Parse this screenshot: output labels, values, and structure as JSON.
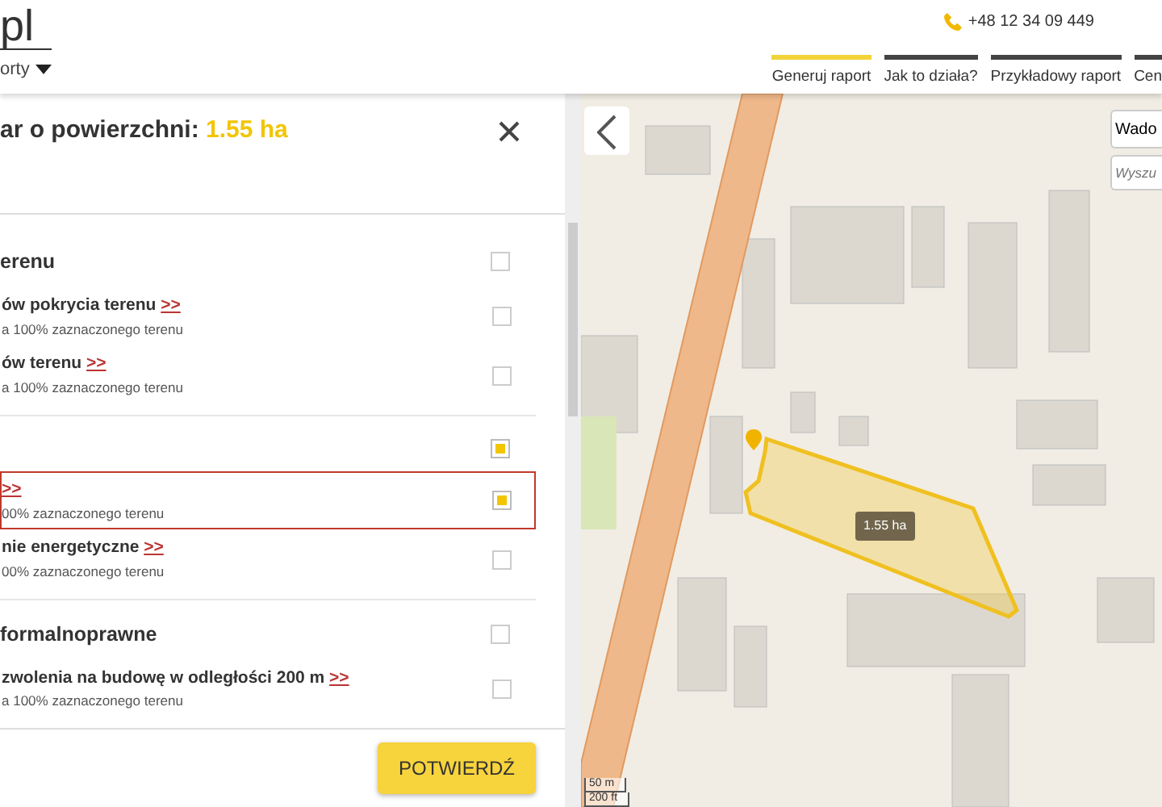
{
  "header": {
    "logo": "pl",
    "menu": "orty",
    "phone": "+48 12 34 09 449",
    "nav": [
      {
        "label": "Generuj raport",
        "selected": true
      },
      {
        "label": "Jak to działa?",
        "selected": false
      },
      {
        "label": "Przykładowy raport",
        "selected": false
      },
      {
        "label": "Cen",
        "selected": false
      }
    ]
  },
  "panel": {
    "title": "ar o powierzchni: ",
    "area": "1.55 ha",
    "confirm": "POTWIERDŹ",
    "sections": [
      {
        "title": "erenu",
        "checked": false,
        "items": [
          {
            "label": "ów pokrycia terenu",
            "link": ">>",
            "note": "a 100% zaznaczonego terenu",
            "checked": false,
            "highlighted": false
          },
          {
            "label": "ów terenu",
            "link": ">>",
            "note": "a 100% zaznaczonego terenu",
            "checked": false,
            "highlighted": false
          }
        ]
      },
      {
        "checked": true,
        "items": [
          {
            "link": ">>",
            "note": "00% zaznaczonego terenu",
            "checked": true,
            "highlighted": true
          },
          {
            "label": "nie energetyczne",
            "link": ">>",
            "note": "00% zaznaczonego terenu",
            "checked": false,
            "highlighted": false
          }
        ]
      },
      {
        "title": "formalnoprawne",
        "checked": false,
        "items": [
          {
            "label": "zwolenia na budowę w odległości 200 m",
            "link": ">>",
            "note": "a 100% zaznaczonego terenu",
            "checked": false,
            "highlighted": false
          }
        ]
      }
    ]
  },
  "map": {
    "search_value": "Wado",
    "search_placeholder": "Wyszu",
    "area_label": "1.55 ha",
    "scale": [
      "50 m",
      "200 ft"
    ]
  }
}
